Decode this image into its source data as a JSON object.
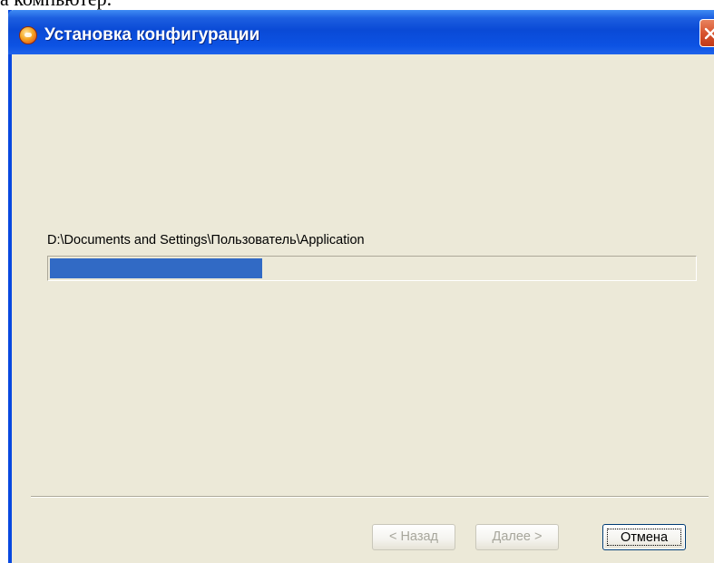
{
  "document": {
    "fragment_text": "а компьютер."
  },
  "window": {
    "title": "Установка конфигурации",
    "icon": "1c-app-icon",
    "close_icon": "close-icon"
  },
  "installer": {
    "current_path": "D:\\Documents and Settings\\Пользователь\\Application",
    "progress_fraction": 0.33,
    "progress_color": "#316ac5"
  },
  "buttons": {
    "back_label": "< Назад",
    "next_label": "Далее >",
    "cancel_label": "Отмена"
  },
  "colors": {
    "title_bar": "#0a4ad6",
    "dialog_background": "#ece9d8",
    "close_button": "#d8542e"
  }
}
